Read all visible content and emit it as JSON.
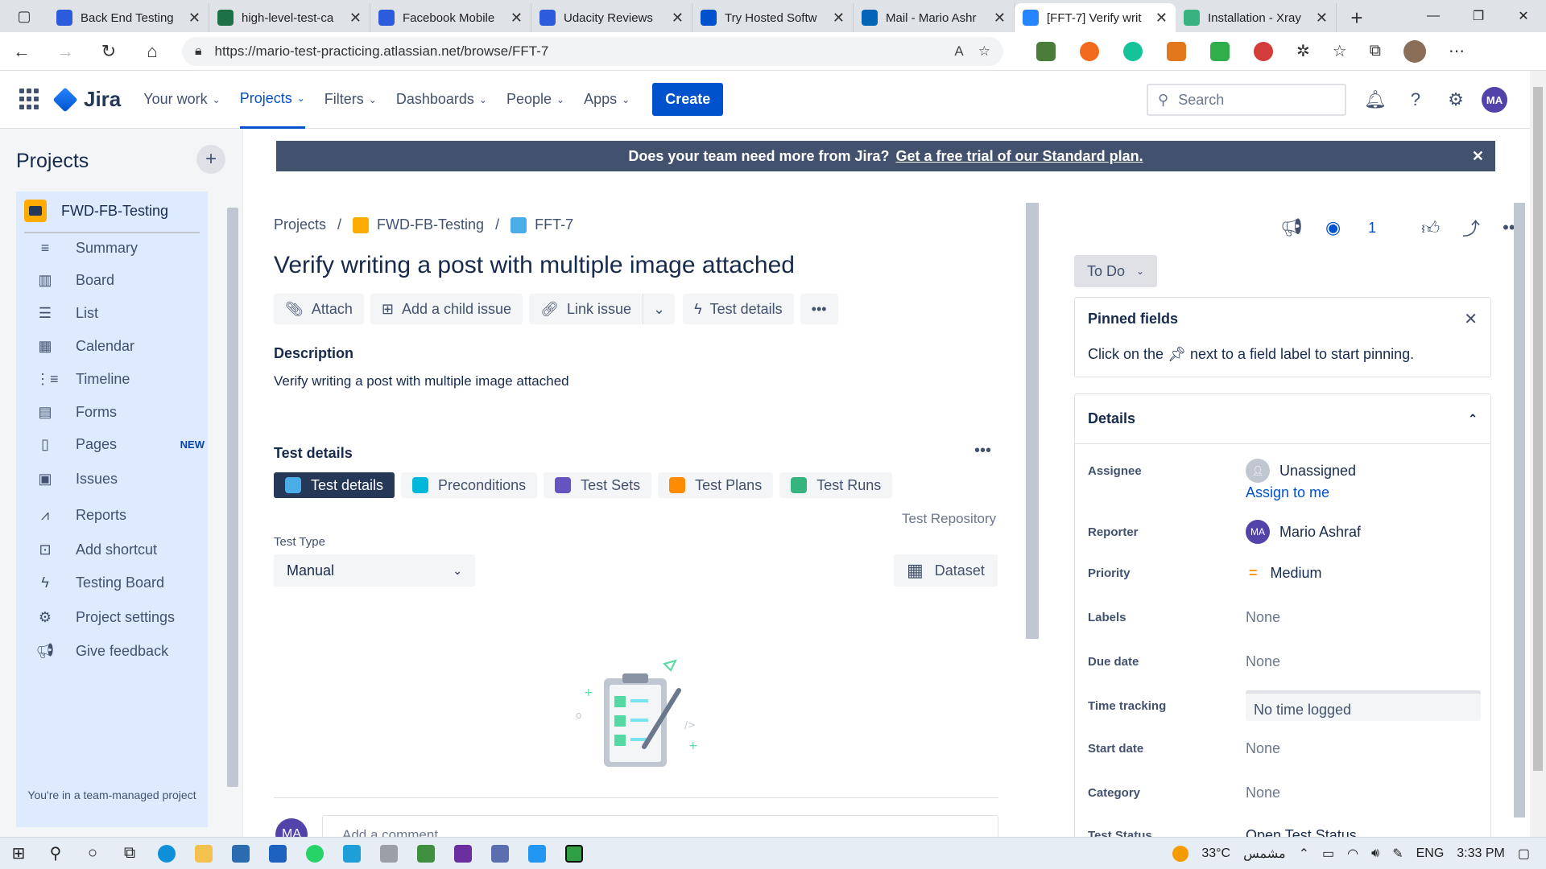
{
  "browser": {
    "tabs": [
      {
        "title": "Back End Testing",
        "color": "#2c5bdb",
        "active": false
      },
      {
        "title": "high-level-test-ca",
        "color": "#1e7145",
        "active": false
      },
      {
        "title": "Facebook Mobile",
        "color": "#2c5bdb",
        "active": false
      },
      {
        "title": "Udacity Reviews",
        "color": "#2c5bdb",
        "active": false
      },
      {
        "title": "Try Hosted Softw",
        "color": "#0052cc",
        "active": false
      },
      {
        "title": "Mail - Mario Ashr",
        "color": "#0364b8",
        "active": false
      },
      {
        "title": "[FFT-7] Verify writ",
        "color": "#2684ff",
        "active": true
      },
      {
        "title": "Installation - Xray",
        "color": "#36b37e",
        "active": false
      }
    ],
    "url": "https://mario-test-practicing.atlassian.net/browse/FFT-7"
  },
  "nav": {
    "product": "Jira",
    "items": [
      "Your work",
      "Projects",
      "Filters",
      "Dashboards",
      "People",
      "Apps"
    ],
    "active": "Projects",
    "create": "Create",
    "search_placeholder": "Search",
    "avatar": "MA"
  },
  "sidebar": {
    "heading": "Projects",
    "project": "FWD-FB-Testing",
    "items": [
      {
        "label": "Summary",
        "icon": "summary-icon"
      },
      {
        "label": "Board",
        "icon": "board-icon"
      },
      {
        "label": "List",
        "icon": "list-icon"
      },
      {
        "label": "Calendar",
        "icon": "calendar-icon"
      },
      {
        "label": "Timeline",
        "icon": "timeline-icon"
      },
      {
        "label": "Forms",
        "icon": "forms-icon"
      },
      {
        "label": "Pages",
        "icon": "pages-icon",
        "badge": "NEW"
      },
      {
        "label": "Issues",
        "icon": "issues-icon"
      },
      {
        "label": "Reports",
        "icon": "reports-icon"
      },
      {
        "label": "Add shortcut",
        "icon": "add-shortcut-icon"
      },
      {
        "label": "Testing Board",
        "icon": "bolt-icon"
      },
      {
        "label": "Project settings",
        "icon": "gear-icon"
      },
      {
        "label": "Give feedback",
        "icon": "megaphone-icon"
      }
    ],
    "footer": "You're in a team-managed project"
  },
  "banner": {
    "text": "Does your team need more from Jira?",
    "link": "Get a free trial of our Standard plan."
  },
  "issue": {
    "breadcrumb": [
      "Projects",
      "FWD-FB-Testing",
      "FFT-7"
    ],
    "title": "Verify writing a post with multiple image attached",
    "actions": [
      "Attach",
      "Add a child issue",
      "Link issue",
      "Test details"
    ],
    "description_label": "Description",
    "description": "Verify writing a post with multiple image attached",
    "test_details_label": "Test details",
    "test_tabs": [
      "Test details",
      "Preconditions",
      "Test Sets",
      "Test Plans",
      "Test Runs"
    ],
    "test_repository": "Test Repository",
    "test_type_label": "Test Type",
    "test_type": "Manual",
    "dataset": "Dataset",
    "comment_placeholder": "Add a comment...",
    "comment_avatar": "MA"
  },
  "panel": {
    "watch_count": "1",
    "status": "To Do",
    "pinned_title": "Pinned fields",
    "pinned_text_a": "Click on the",
    "pinned_text_b": "next to a field label to start pinning.",
    "details_title": "Details",
    "fields": {
      "assignee_label": "Assignee",
      "assignee": "Unassigned",
      "assign_to_me": "Assign to me",
      "reporter_label": "Reporter",
      "reporter": "Mario Ashraf",
      "reporter_initials": "MA",
      "priority_label": "Priority",
      "priority": "Medium",
      "labels_label": "Labels",
      "labels": "None",
      "due_label": "Due date",
      "due": "None",
      "time_label": "Time tracking",
      "time": "No time logged",
      "start_label": "Start date",
      "start": "None",
      "category_label": "Category",
      "category": "None",
      "teststatus_label": "Test Status",
      "teststatus": "Open Test Status"
    }
  },
  "taskbar": {
    "temperature": "33°C",
    "weather": "مشمس",
    "lang": "ENG",
    "time": "3:33 PM"
  }
}
